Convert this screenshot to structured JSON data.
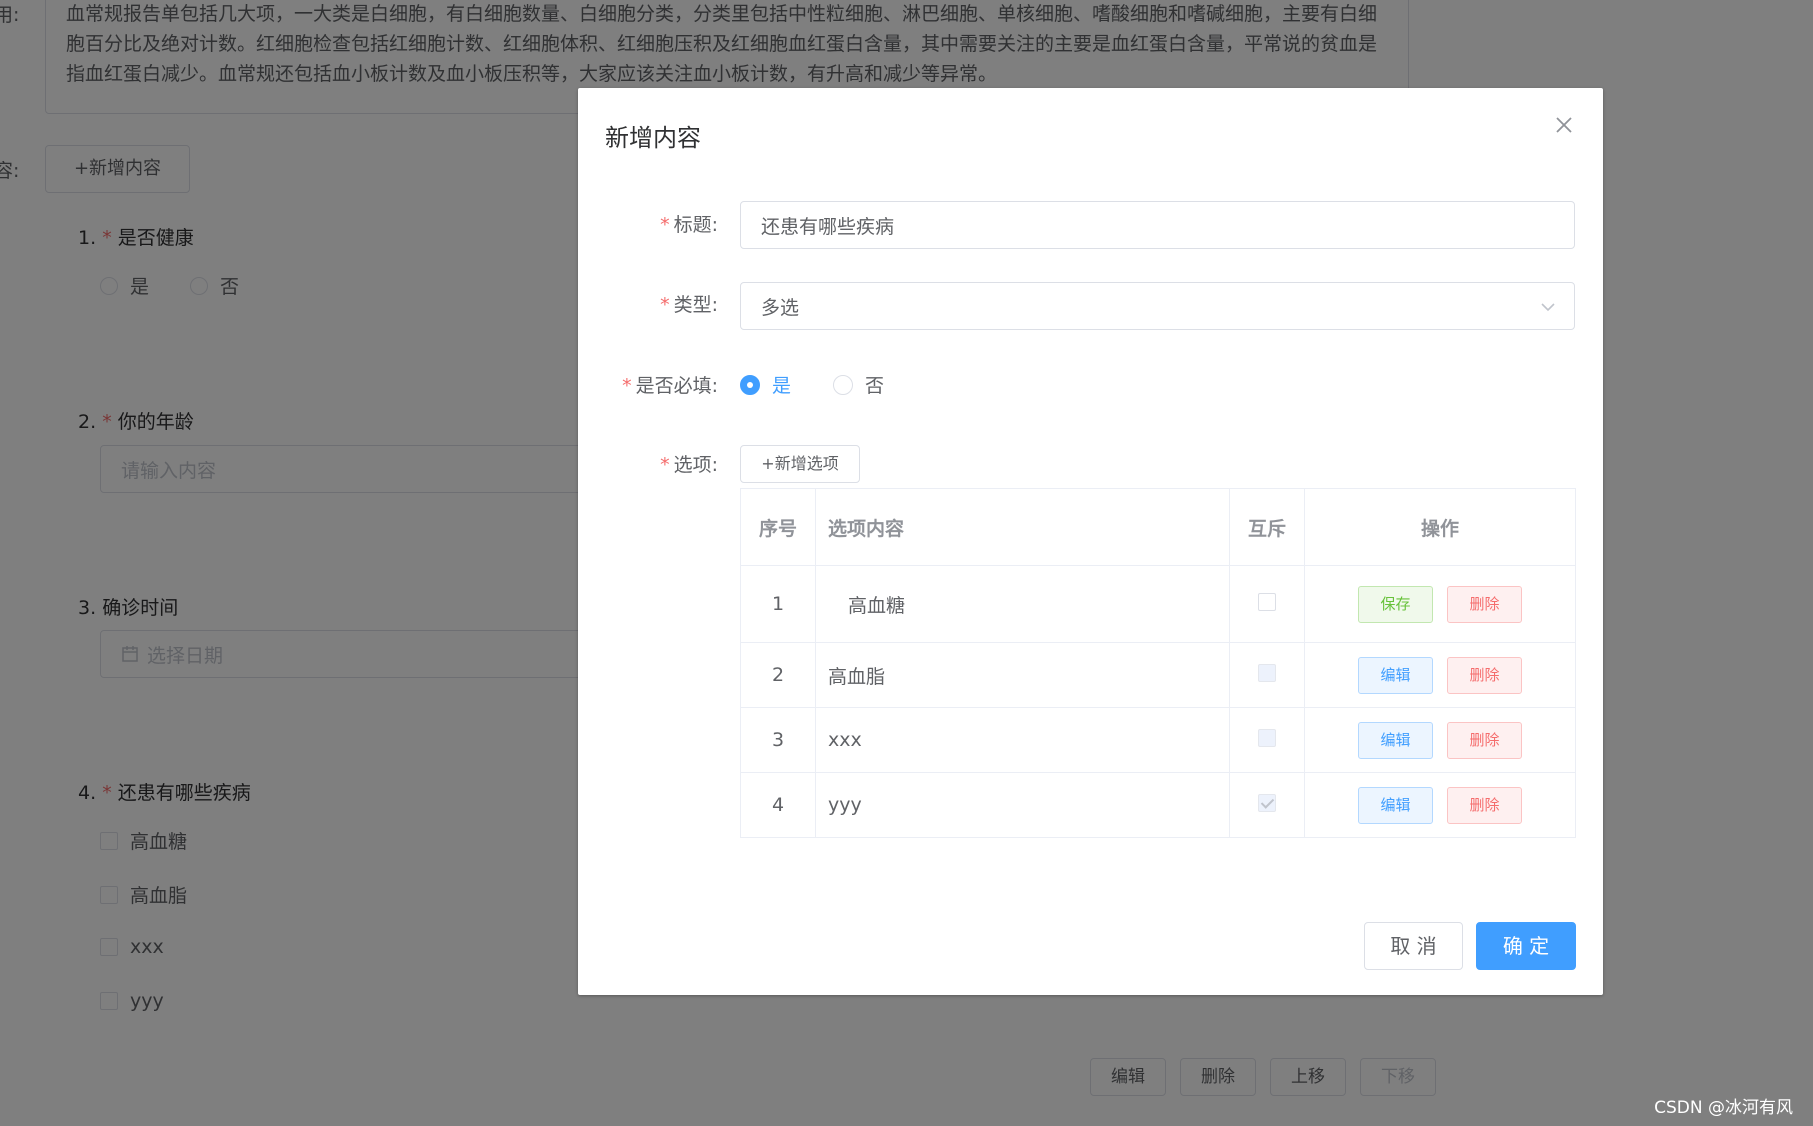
{
  "background": {
    "desc_label": "用:",
    "desc_text": "血常规报告单包括几大项，一大类是白细胞，有白细胞数量、白细胞分类，分类里包括中性粒细胞、淋巴细胞、单核细胞、嗜酸细胞和嗜碱细胞，主要有白细胞百分比及绝对计数。红细胞检查包括红细胞计数、红细胞体积、红细胞压积及红细胞血红蛋白含量，其中需要关注的主要是血红蛋白含量，平常说的贫血是指血红蛋白减少。血常规还包括血小板计数及血小板压积等，大家应该关注血小板计数，有升高和减少等异常。",
    "content_label": "容:",
    "add_content_button": "+新增内容",
    "questions": [
      {
        "number": "1.",
        "required": true,
        "title": "是否健康",
        "options": [
          "是",
          "否"
        ]
      },
      {
        "number": "2.",
        "required": true,
        "title": "你的年龄",
        "placeholder": "请输入内容"
      },
      {
        "number": "3.",
        "required": false,
        "title": "确诊时间",
        "placeholder": "选择日期"
      },
      {
        "number": "4.",
        "required": true,
        "title": "还患有哪些疾病",
        "options": [
          "高血糖",
          "高血脂",
          "xxx",
          "yyy"
        ]
      }
    ],
    "action_buttons": [
      "编辑",
      "删除",
      "上移",
      "下移"
    ]
  },
  "dialog": {
    "title": "新增内容",
    "fields": {
      "title_label": "标题:",
      "title_value": "还患有哪些疾病",
      "type_label": "类型:",
      "type_value": "多选",
      "required_label": "是否必填:",
      "required_yes": "是",
      "required_no": "否",
      "options_label": "选项:",
      "add_option_button": "+新增选项"
    },
    "table": {
      "headers": [
        "序号",
        "选项内容",
        "互斥",
        "操作"
      ],
      "rows": [
        {
          "no": "1",
          "content": "高血糖",
          "mutex": false,
          "editing": true,
          "btn1": "保存",
          "btn2": "删除"
        },
        {
          "no": "2",
          "content": "高血脂",
          "mutex": false,
          "editing": false,
          "btn1": "编辑",
          "btn2": "删除"
        },
        {
          "no": "3",
          "content": "xxx",
          "mutex": false,
          "editing": false,
          "btn1": "编辑",
          "btn2": "删除"
        },
        {
          "no": "4",
          "content": "yyy",
          "mutex": true,
          "editing": false,
          "btn1": "编辑",
          "btn2": "删除"
        }
      ]
    },
    "cancel_button": "取 消",
    "confirm_button": "确 定"
  },
  "watermark": "CSDN @冰河有风",
  "colors": {
    "primary": "#409eff",
    "danger": "#f56c6c",
    "success": "#67c23a",
    "overlay": "rgba(0,0,0,0.5)"
  }
}
